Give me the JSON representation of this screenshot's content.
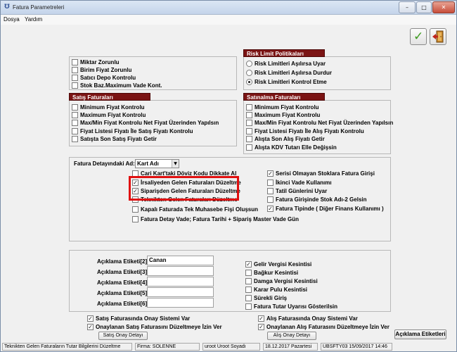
{
  "window": {
    "title": "Fatura Parametreleri",
    "minimize": "–",
    "maximize": "□",
    "close": "✕"
  },
  "menu": [
    "Dosya",
    "Yardım"
  ],
  "general_checks": [
    {
      "label": "Miktar Zorunlu",
      "checked": false
    },
    {
      "label": "Birim Fiyat Zorunlu",
      "checked": false
    },
    {
      "label": "Satıcı Depo Kontrolu",
      "checked": false
    },
    {
      "label": "Stok Baz.Maximum Vade Kont.",
      "checked": false
    }
  ],
  "risk": {
    "title": "Risk Limit Politikaları",
    "options": [
      {
        "label": "Risk Limitleri Aşılırsa Uyar",
        "selected": false
      },
      {
        "label": "Risk Limitleri Aşılırsa Durdur",
        "selected": false
      },
      {
        "label": "Risk Limitleri Kontrol Etme",
        "selected": true
      }
    ]
  },
  "satis": {
    "title": "Satış Faturaları",
    "items": [
      {
        "label": "Minimum  Fiyat Kontrolu",
        "checked": false
      },
      {
        "label": "Maximum Fiyat Kontrolu",
        "checked": false
      },
      {
        "label": "Max/Min Fiyat Kontrolu Net Fiyat Üzerinden Yapılsın",
        "checked": false
      },
      {
        "label": "Fiyat Listesi Fiyatı İle Satış Fiyatı Kontrolu",
        "checked": false
      },
      {
        "label": "Satışta Son Satış Fiyatı Getir",
        "checked": false
      }
    ]
  },
  "satinalma": {
    "title": "Satınalma Faturaları",
    "items": [
      {
        "label": "Minimum Fiyat Kontrolu",
        "checked": false
      },
      {
        "label": "Maximum Fiyat Kontrolu",
        "checked": false
      },
      {
        "label": "Max/Min Fiyat Kontrolu Net Fiyat Üzerinden Yapılsın",
        "checked": false
      },
      {
        "label": "Fiyat Listesi Fiyatı İle Alış Fiyatı Kontrolu",
        "checked": false
      },
      {
        "label": "Alışta Son Alış Fiyatı Getir",
        "checked": false
      },
      {
        "label": "Alışta KDV Tutarı Elle Değişsin",
        "checked": false
      }
    ]
  },
  "detail": {
    "label": "Fatura Detayındaki Ad:",
    "select": "Kart Adı",
    "left": [
      {
        "label": "Cari Kart'taki Döviz Kodu Dikkate Al",
        "checked": false
      },
      {
        "label": "İrsaliyeden Gelen Faturaları Düzeltme",
        "checked": true
      },
      {
        "label": "Siparişden Gelen Faturaları Düzeltme",
        "checked": true
      },
      {
        "label": "Teknikten Gelen Faturaları Düzeltme",
        "checked": false
      },
      {
        "label": "Kapalı Faturada Tek Muhasebe Fişi Oluşsun",
        "checked": false
      },
      {
        "label": "Fatura Detay Vade; Fatura Tarihi + Sipariş Master Vade Gün",
        "checked": false
      }
    ],
    "right": [
      {
        "label": "Serisi Olmayan Stoklara Fatura Girişi",
        "checked": true
      },
      {
        "label": "İkinci Vade Kullanımı",
        "checked": false
      },
      {
        "label": "Tatil Günlerini Uyar",
        "checked": false
      },
      {
        "label": "Fatura Girişinde Stok Adı-2 Gelsin",
        "checked": false
      },
      {
        "label": "Fatura Tipinde ( Diğer Finans Kullanımı )",
        "checked": true
      }
    ]
  },
  "aciklama": [
    {
      "label": "Açıklama Etiketi[2]:",
      "value": "Canan"
    },
    {
      "label": "Açıklama Etiketi[3]:",
      "value": ""
    },
    {
      "label": "Açıklama Etiketi[4]:",
      "value": ""
    },
    {
      "label": "Açıklama Etiketi[5]:",
      "value": ""
    },
    {
      "label": "Açıklama Etiketi[6]:",
      "value": ""
    }
  ],
  "kesinti": [
    {
      "label": "Gelir Vergisi Kesintisi",
      "checked": true
    },
    {
      "label": "Bağkur Kesintisi",
      "checked": false
    },
    {
      "label": "Damga Vergisi Kesintisi",
      "checked": false
    },
    {
      "label": "Karar Pulu Kesintisi",
      "checked": false
    },
    {
      "label": "Sürekli Giriş",
      "checked": false
    },
    {
      "label": "Fatura Tutar Uyarısı Gösterilsin",
      "checked": false
    }
  ],
  "onay": {
    "satis": [
      {
        "label": "Satış Faturasında Onay Sistemi Var",
        "checked": true
      },
      {
        "label": "Onaylanan Satış Faturasını Düzeltmeye İzin Ver",
        "checked": true
      }
    ],
    "satis_button": "Satış Onay Detayı",
    "alis": [
      {
        "label": "Alış Faturasında Onay Sistemi Var",
        "checked": true
      },
      {
        "label": "Onaylanan Alış Faturasını Düzeltmeye İzin Ver",
        "checked": true
      }
    ],
    "alis_button": "Alış Onay Detayı",
    "aciklama_button": "Açıklama Etiketleri"
  },
  "status": [
    "Teknikten Gelen Faturaların Tutar Bilgilerini Düzeltme",
    "Firma: SOLENNE",
    "uroot Uroot Soyadı",
    "18.12.2017  Pazartesi",
    "UBSFTY03 15/09/2017 14:46"
  ]
}
